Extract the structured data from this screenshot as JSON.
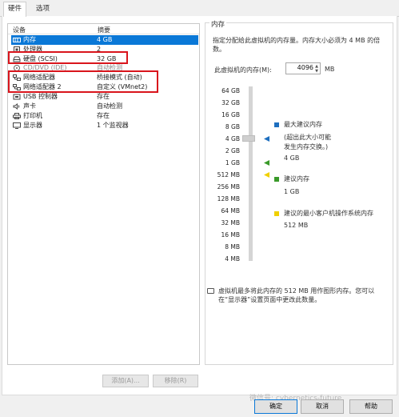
{
  "tabs": [
    {
      "label": "硬件",
      "active": true
    },
    {
      "label": "选项",
      "active": false
    }
  ],
  "device_list": {
    "headers": {
      "device": "设备",
      "summary": "摘要"
    },
    "rows": [
      {
        "name": "内存",
        "summary": "4 GB",
        "icon": "memory-icon",
        "selected": true
      },
      {
        "name": "处理器",
        "summary": "2",
        "icon": "cpu-icon"
      },
      {
        "name": "硬盘 (SCSI)",
        "summary": "32 GB",
        "icon": "hard-disk-icon"
      },
      {
        "name": "CD/DVD (IDE)",
        "summary": "自动检测",
        "icon": "cd-dvd-icon"
      },
      {
        "name": "网络适配器",
        "summary": "桥接模式 (自动)",
        "icon": "network-adapter-icon"
      },
      {
        "name": "网络适配器 2",
        "summary": "自定义 (VMnet2)",
        "icon": "network-adapter-icon"
      },
      {
        "name": "USB 控制器",
        "summary": "存在",
        "icon": "usb-icon"
      },
      {
        "name": "声卡",
        "summary": "自动检测",
        "icon": "sound-card-icon"
      },
      {
        "name": "打印机",
        "summary": "存在",
        "icon": "printer-icon"
      },
      {
        "name": "显示器",
        "summary": "1 个监视器",
        "icon": "monitor-icon"
      }
    ]
  },
  "buttons": {
    "add": "添加(A)...",
    "remove": "移除(R)"
  },
  "memory": {
    "group_title": "内存",
    "description": "指定分配给此虚拟机的内存量。内存大小必须为 4 MB 的倍数。",
    "field_label": "此虚拟机的内存(M):",
    "value": "4096",
    "unit": "MB",
    "ticks": [
      "64 GB",
      "32 GB",
      "16 GB",
      "8 GB",
      "4 GB",
      "2 GB",
      "1 GB",
      "512 MB",
      "256 MB",
      "128 MB",
      "64 MB",
      "32 MB",
      "16 MB",
      "8 MB",
      "4 MB"
    ],
    "current_value_fraction": 0.286,
    "legend": [
      {
        "label": "最大建议内存",
        "note": "(超出此大小可能\n发生内存交换。)",
        "value": "4 GB",
        "color": "#1e6fbf"
      },
      {
        "label": "建议内存",
        "value": "1 GB",
        "color": "#3a9a2a"
      },
      {
        "label": "建议的最小客户机操作系统内存",
        "value": "512 MB",
        "color": "#f0d000"
      }
    ],
    "note": "虚拟机最多将此内存的 512 MB 用作图形内存。您可以在“显示器”设置页面中更改此数量。"
  },
  "dialog_buttons": {
    "ok": "确定",
    "cancel": "取消",
    "help": "帮助"
  },
  "watermark": "微信号: cybernetics-future"
}
